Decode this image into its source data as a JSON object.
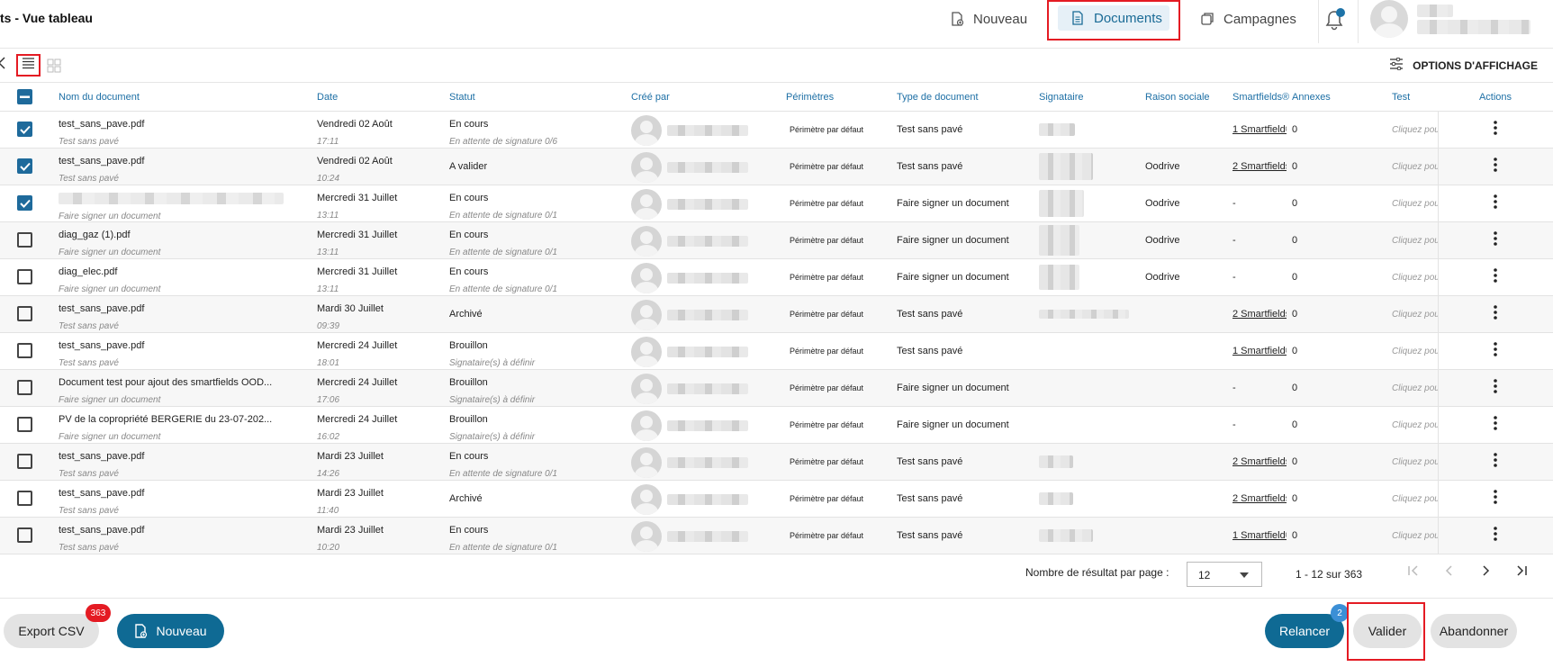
{
  "header": {
    "title": "ts - Vue tableau",
    "nav": [
      {
        "label": "Nouveau"
      },
      {
        "label": "Documents"
      },
      {
        "label": "Campagnes"
      }
    ]
  },
  "toolbar": {
    "display_options": "OPTIONS D'AFFICHAGE"
  },
  "table": {
    "columns": [
      "Nom du document",
      "Date",
      "Statut",
      "Créé par",
      "Périmètres",
      "Type de document",
      "Signataire",
      "Raison sociale",
      "Smartfields®",
      "Annexes",
      "Test",
      "Actions"
    ],
    "rows": [
      {
        "name": "test_sans_pave.pdf",
        "subtype": "Test sans pavé",
        "date": "Vendredi 02 Août",
        "time": "17:11",
        "status": "En cours",
        "status_sub": "En attente de signature 0/6",
        "perimeter": "Périmètre par défaut",
        "doctype": "Test sans pavé",
        "raison": "",
        "smartfields": "1 Smartfield®",
        "annexes": "0",
        "test": "Cliquez pour éditer",
        "checked": true
      },
      {
        "name": "test_sans_pave.pdf",
        "subtype": "Test sans pavé",
        "date": "Vendredi 02 Août",
        "time": "10:24",
        "status": "A valider",
        "status_sub": "",
        "perimeter": "Périmètre par défaut",
        "doctype": "Test sans pavé",
        "raison": "Oodrive",
        "smartfields": "2 Smartfields®",
        "annexes": "0",
        "test": "Cliquez pour éditer",
        "checked": true
      },
      {
        "name": "",
        "subtype": "Faire signer un document",
        "date": "Mercredi 31 Juillet",
        "time": "13:11",
        "status": "En cours",
        "status_sub": "En attente de signature 0/1",
        "perimeter": "Périmètre par défaut",
        "doctype": "Faire signer un document",
        "raison": "Oodrive",
        "smartfields": "-",
        "annexes": "0",
        "test": "Cliquez pour éditer",
        "checked": true
      },
      {
        "name": "diag_gaz (1).pdf",
        "subtype": "Faire signer un document",
        "date": "Mercredi 31 Juillet",
        "time": "13:11",
        "status": "En cours",
        "status_sub": "En attente de signature 0/1",
        "perimeter": "Périmètre par défaut",
        "doctype": "Faire signer un document",
        "raison": "Oodrive",
        "smartfields": "-",
        "annexes": "0",
        "test": "Cliquez pour éditer",
        "checked": false
      },
      {
        "name": "diag_elec.pdf",
        "subtype": "Faire signer un document",
        "date": "Mercredi 31 Juillet",
        "time": "13:11",
        "status": "En cours",
        "status_sub": "En attente de signature 0/1",
        "perimeter": "Périmètre par défaut",
        "doctype": "Faire signer un document",
        "raison": "Oodrive",
        "smartfields": "-",
        "annexes": "0",
        "test": "Cliquez pour éditer",
        "checked": false
      },
      {
        "name": "test_sans_pave.pdf",
        "subtype": "Test sans pavé",
        "date": "Mardi 30 Juillet",
        "time": "09:39",
        "status": "Archivé",
        "status_sub": "",
        "perimeter": "Périmètre par défaut",
        "doctype": "Test sans pavé",
        "raison": "",
        "smartfields": "2 Smartfields®",
        "annexes": "0",
        "test": "Cliquez pour éditer",
        "checked": false
      },
      {
        "name": "test_sans_pave.pdf",
        "subtype": "Test sans pavé",
        "date": "Mercredi 24 Juillet",
        "time": "18:01",
        "status": "Brouillon",
        "status_sub": "Signataire(s) à définir",
        "perimeter": "Périmètre par défaut",
        "doctype": "Test sans pavé",
        "raison": "",
        "smartfields": "1 Smartfield®",
        "annexes": "0",
        "test": "Cliquez pour éditer",
        "checked": false
      },
      {
        "name": "Document test pour ajout des smartfields OOD...",
        "subtype": "Faire signer un document",
        "date": "Mercredi 24 Juillet",
        "time": "17:06",
        "status": "Brouillon",
        "status_sub": "Signataire(s) à définir",
        "perimeter": "Périmètre par défaut",
        "doctype": "Faire signer un document",
        "raison": "",
        "smartfields": "-",
        "annexes": "0",
        "test": "Cliquez pour éditer",
        "checked": false
      },
      {
        "name": "PV de la copropriété BERGERIE du 23-07-202...",
        "subtype": "Faire signer un document",
        "date": "Mercredi 24 Juillet",
        "time": "16:02",
        "status": "Brouillon",
        "status_sub": "Signataire(s) à définir",
        "perimeter": "Périmètre par défaut",
        "doctype": "Faire signer un document",
        "raison": "",
        "smartfields": "-",
        "annexes": "0",
        "test": "Cliquez pour éditer",
        "checked": false
      },
      {
        "name": "test_sans_pave.pdf",
        "subtype": "Test sans pavé",
        "date": "Mardi 23 Juillet",
        "time": "14:26",
        "status": "En cours",
        "status_sub": "En attente de signature 0/1",
        "perimeter": "Périmètre par défaut",
        "doctype": "Test sans pavé",
        "raison": "",
        "smartfields": "2 Smartfields®",
        "annexes": "0",
        "test": "Cliquez pour éditer",
        "checked": false
      },
      {
        "name": "test_sans_pave.pdf",
        "subtype": "Test sans pavé",
        "date": "Mardi 23 Juillet",
        "time": "11:40",
        "status": "Archivé",
        "status_sub": "",
        "perimeter": "Périmètre par défaut",
        "doctype": "Test sans pavé",
        "raison": "",
        "smartfields": "2 Smartfields®",
        "annexes": "0",
        "test": "Cliquez pour éditer",
        "checked": false
      },
      {
        "name": "test_sans_pave.pdf",
        "subtype": "Test sans pavé",
        "date": "Mardi 23 Juillet",
        "time": "10:20",
        "status": "En cours",
        "status_sub": "En attente de signature 0/1",
        "perimeter": "Périmètre par défaut",
        "doctype": "Test sans pavé",
        "raison": "",
        "smartfields": "1 Smartfield®",
        "annexes": "0",
        "test": "Cliquez pour éditer",
        "checked": false
      }
    ]
  },
  "pagination": {
    "per_page_label": "Nombre de résultat par page :",
    "per_page_value": "12",
    "range": "1 - 12 sur 363"
  },
  "footer": {
    "export_label": "Export CSV",
    "export_count": "363",
    "new_label": "Nouveau",
    "relancer_label": "Relancer",
    "relancer_count": "2",
    "valider_label": "Valider",
    "abandonner_label": "Abandonner"
  },
  "colors": {
    "accent": "#0f6a94",
    "header_link": "#1d6fa5",
    "highlight": "#e41b23",
    "badge_red": "#e41b23",
    "badge_blue": "#3b8fd6"
  },
  "icons": [
    "new-doc-icon",
    "document-icon",
    "campaign-icon",
    "bell-icon",
    "back-icon",
    "list-view-icon",
    "grid-view-icon",
    "options-icon",
    "kebab-icon",
    "first-page-icon",
    "prev-page-icon",
    "next-page-icon",
    "last-page-icon"
  ]
}
